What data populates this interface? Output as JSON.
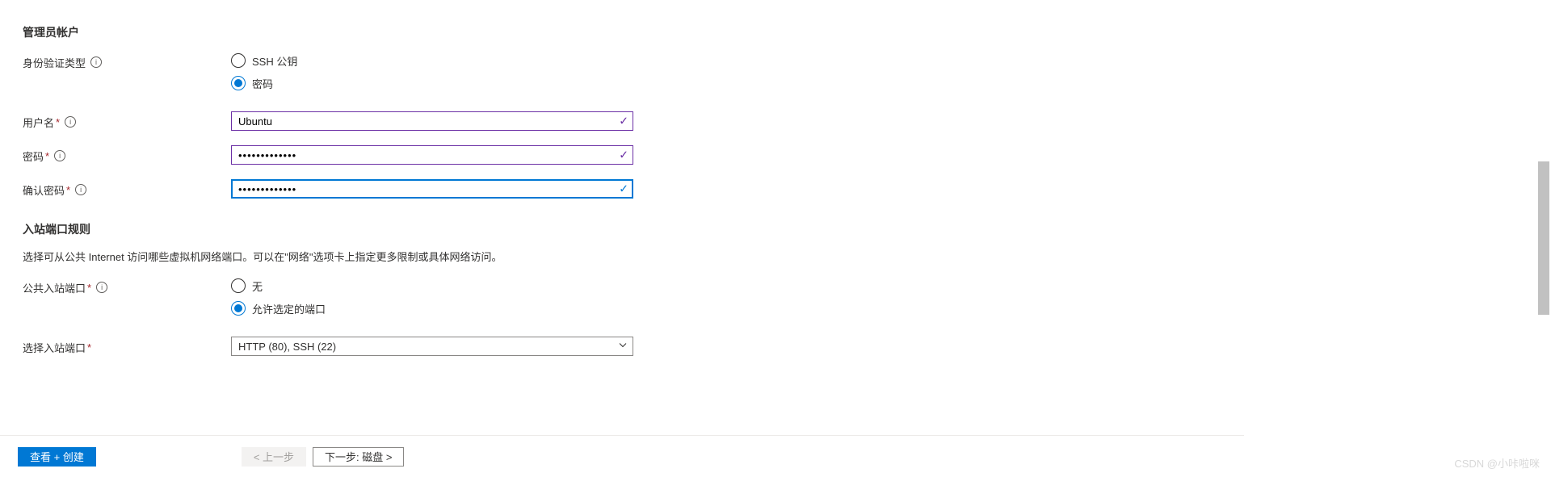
{
  "admin": {
    "section_title": "管理员帐户",
    "auth_type": {
      "label": "身份验证类型",
      "ssh_label": "SSH 公钥",
      "password_label": "密码",
      "selected": "password"
    },
    "username": {
      "label": "用户名",
      "value": "Ubuntu"
    },
    "password": {
      "label": "密码",
      "value": "•••••••••••••"
    },
    "confirm": {
      "label": "确认密码",
      "value": "•••••••••••••"
    }
  },
  "inbound": {
    "section_title": "入站端口规则",
    "description": "选择可从公共 Internet 访问哪些虚拟机网络端口。可以在\"网络\"选项卡上指定更多限制或具体网络访问。",
    "public_ports": {
      "label": "公共入站端口",
      "none_label": "无",
      "allow_label": "允许选定的端口",
      "selected": "allow"
    },
    "select_ports": {
      "label": "选择入站端口",
      "value": "HTTP (80), SSH (22)"
    }
  },
  "footer": {
    "review_create": "查看 + 创建",
    "prev": "< 上一步",
    "next": "下一步: 磁盘 >"
  },
  "watermark": "CSDN @小咔啦咪"
}
